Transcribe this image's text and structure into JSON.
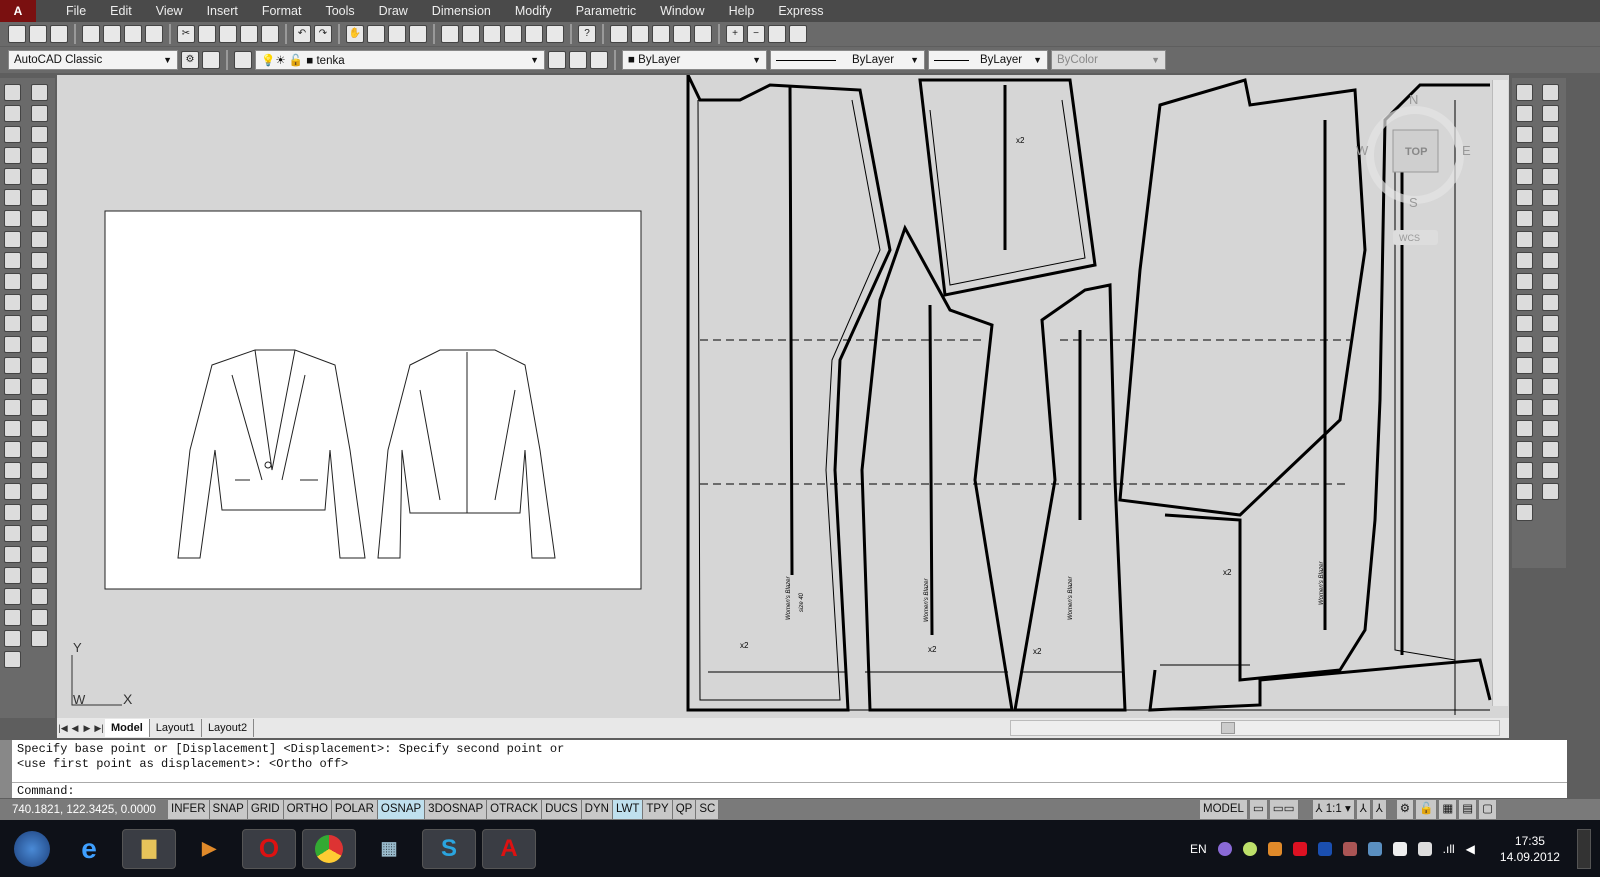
{
  "menu": [
    "File",
    "Edit",
    "View",
    "Insert",
    "Format",
    "Tools",
    "Draw",
    "Dimension",
    "Modify",
    "Parametric",
    "Window",
    "Help",
    "Express"
  ],
  "toolbar": {
    "workspace": "AutoCAD Classic",
    "layer": "tenka",
    "color": "ByLayer",
    "linetype": "ByLayer",
    "lineweight": "ByLayer",
    "plotstyle": "ByColor"
  },
  "viewcube": {
    "top": "TOP",
    "n": "N",
    "s": "S",
    "w": "W",
    "e": "E",
    "ucs": "WCS"
  },
  "ucs_icon": {
    "x": "X",
    "y": "Y",
    "w": "W"
  },
  "pattern_labels": {
    "mult": "x2",
    "piece_text": "Women's Blazer",
    "size": "size 40"
  },
  "layout_tabs": [
    "Model",
    "Layout1",
    "Layout2"
  ],
  "command": {
    "history": [
      "Specify base point or [Displacement] <Displacement>: Specify second point or",
      "<use first point as displacement>:  <Ortho off>"
    ],
    "prompt": "Command:"
  },
  "status": {
    "coords": "740.1821, 122.3425, 0.0000",
    "toggles": [
      {
        "label": "INFER",
        "on": false
      },
      {
        "label": "SNAP",
        "on": false
      },
      {
        "label": "GRID",
        "on": false
      },
      {
        "label": "ORTHO",
        "on": false
      },
      {
        "label": "POLAR",
        "on": false
      },
      {
        "label": "OSNAP",
        "on": true
      },
      {
        "label": "3DOSNAP",
        "on": false
      },
      {
        "label": "OTRACK",
        "on": false
      },
      {
        "label": "DUCS",
        "on": false
      },
      {
        "label": "DYN",
        "on": false
      },
      {
        "label": "LWT",
        "on": true
      },
      {
        "label": "TPY",
        "on": false
      },
      {
        "label": "QP",
        "on": false
      },
      {
        "label": "SC",
        "on": false
      }
    ],
    "model": "MODEL",
    "scale": "1:1"
  },
  "taskbar": {
    "lang": "EN",
    "time": "17:35",
    "date": "14.09.2012"
  }
}
